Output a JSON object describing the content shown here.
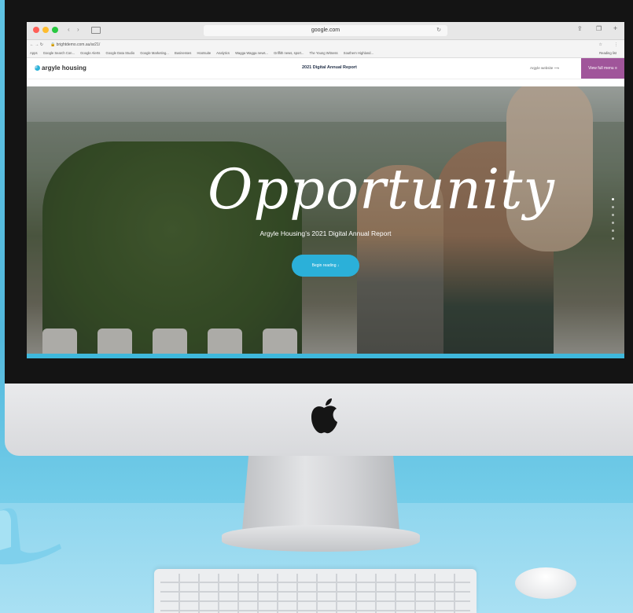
{
  "browser": {
    "url": "google.com",
    "address": "brightdemo.com.au/ar21/",
    "bookmarks": [
      "Apps",
      "Google Search Con...",
      "Google Alerts",
      "Google Data Studio",
      "Google Marketing...",
      "Businesses",
      "Hootsuite",
      "Analytics",
      "Wagga Wagga news...",
      "Griffith news, sport...",
      "The Young Witness",
      "Southern Highland..."
    ],
    "reading_list": "Reading list"
  },
  "site": {
    "logo_text": "argyle housing",
    "header_title": "2021 Digital Annual Report",
    "argyle_link": "Argyle website",
    "menu_label": "View full menu"
  },
  "hero": {
    "headline": "Opportunity",
    "subtitle": "Argyle Housing’s 2021 Digital Annual Report",
    "cta": "Begin reading"
  }
}
